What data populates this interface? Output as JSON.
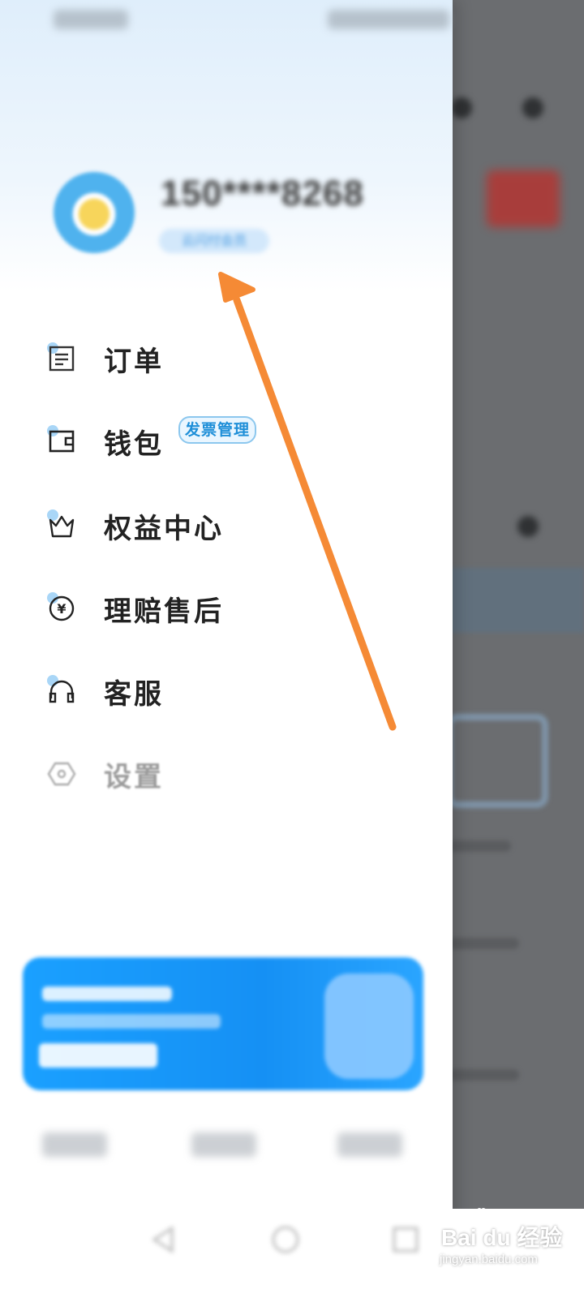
{
  "profile": {
    "username": "150****8268",
    "member_tag": "云闪付会员"
  },
  "menu": [
    {
      "label": "订单",
      "icon": "order-list-icon"
    },
    {
      "label": "钱包",
      "icon": "wallet-icon",
      "badge": "发票管理"
    },
    {
      "label": "权益中心",
      "icon": "crown-icon"
    },
    {
      "label": "理赔售后",
      "icon": "yuan-refund-icon"
    },
    {
      "label": "客服",
      "icon": "headset-icon"
    },
    {
      "label": "设置",
      "icon": "hexagon-settings-icon"
    }
  ],
  "watermark": {
    "brand": "Bai  du 经验",
    "url": "jingyan.baidu.com"
  },
  "colors": {
    "accent": "#1f8fd8",
    "banner": "#1590f4",
    "annotation_arrow": "#f58a35"
  }
}
